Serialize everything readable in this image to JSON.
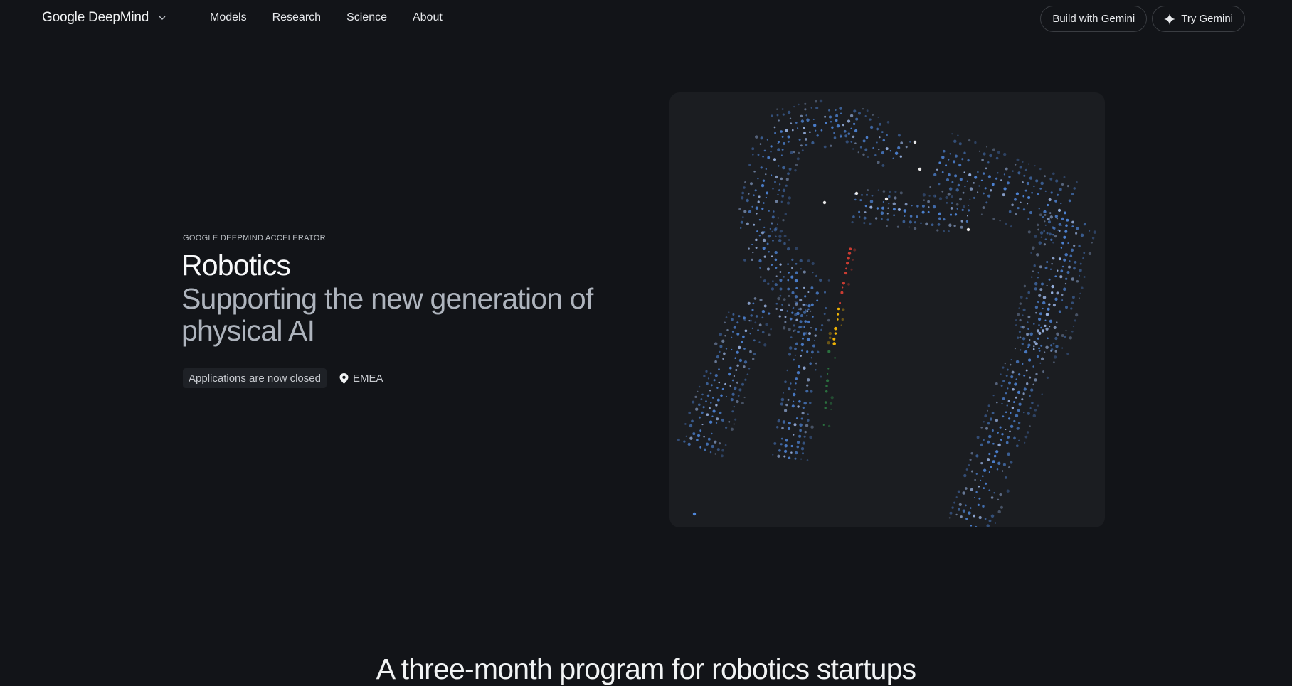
{
  "nav": {
    "brand": "Google DeepMind",
    "links": [
      "Models",
      "Research",
      "Science",
      "About"
    ],
    "build_label": "Build with Gemini",
    "try_label": "Try Gemini"
  },
  "hero": {
    "eyebrow": "GOOGLE DEEPMIND ACCELERATOR",
    "title": "Robotics",
    "subtitle": "Supporting the new generation of physical AI",
    "status": "Applications are now closed",
    "location": "EMEA"
  },
  "media": {
    "icon": "dotted-robot-arm-illustration",
    "colors": [
      "#4f86d9",
      "#9bb6e6",
      "#e94235",
      "#fbbc04",
      "#34a853",
      "#ffffff"
    ]
  },
  "section": {
    "title": "A three-month program for robotics startups"
  },
  "colors": {
    "background": "#121418",
    "panel": "#1b1d21",
    "border": "#3a3d42"
  }
}
